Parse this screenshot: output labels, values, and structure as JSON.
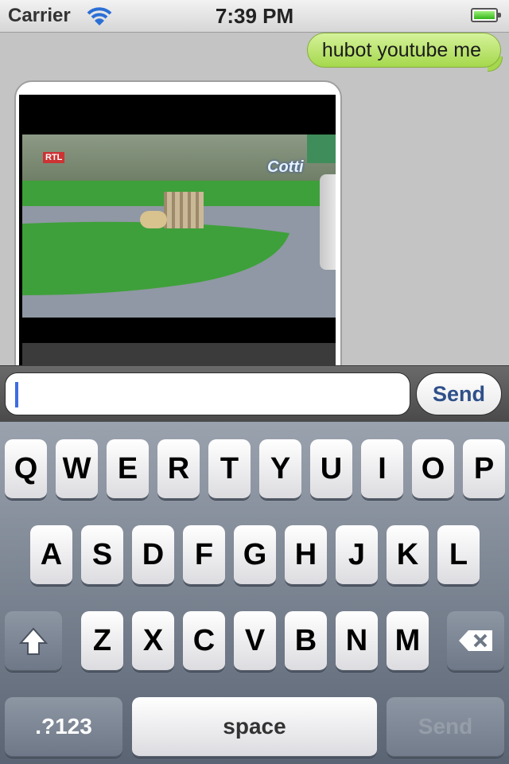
{
  "status_bar": {
    "carrier": "Carrier",
    "time": "7:39 PM"
  },
  "chat": {
    "messages": [
      {
        "text": "hubot youtube me"
      }
    ]
  },
  "composer": {
    "value": "",
    "send_label": "Send"
  },
  "keyboard": {
    "row1": [
      "Q",
      "W",
      "E",
      "R",
      "T",
      "Y",
      "U",
      "I",
      "O",
      "P"
    ],
    "row2": [
      "A",
      "S",
      "D",
      "F",
      "G",
      "H",
      "J",
      "K",
      "L"
    ],
    "row3": [
      "Z",
      "X",
      "C",
      "V",
      "B",
      "N",
      "M"
    ],
    "numbers_label": ".?123",
    "space_label": "space",
    "return_label": "Send"
  },
  "colors": {
    "outgoing_bubble": "#a5d84d",
    "send_text": "#2f4f8a",
    "caret": "#3e6ddf"
  }
}
